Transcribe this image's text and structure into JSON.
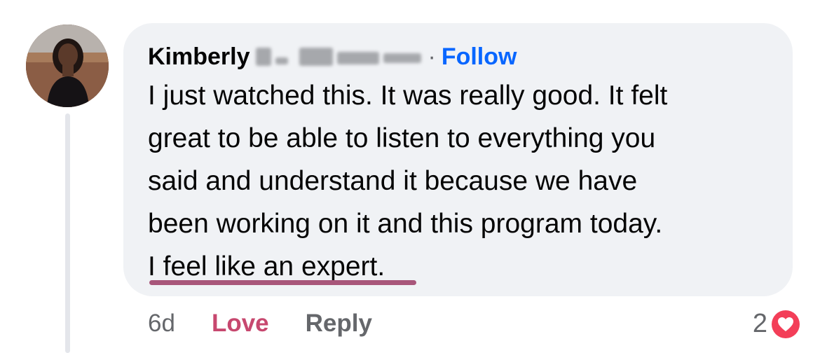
{
  "comment": {
    "author_first_name": "Kimberly",
    "separator": "·",
    "follow_label": "Follow",
    "lines": [
      "I just watched this. It was really good. It felt",
      "great to be able to listen to everything you",
      "said and understand it because we have",
      "been working on it and this program today.",
      "I feel like an expert."
    ]
  },
  "actions": {
    "timestamp": "6d",
    "love_label": "Love",
    "reply_label": "Reply"
  },
  "reactions": {
    "count": "2",
    "icon": "heart-icon"
  },
  "colors": {
    "follow": "#0866ff",
    "love_action": "#c7486f",
    "bubble_bg": "#f0f2f5",
    "underline_annotation": "#a8567a",
    "love_reaction": "#f33e58"
  }
}
